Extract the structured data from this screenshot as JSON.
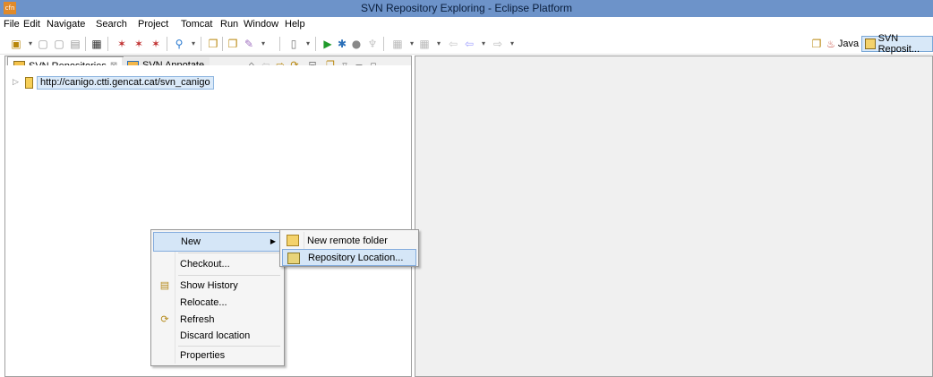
{
  "window": {
    "title": "SVN Repository Exploring - Eclipse Platform",
    "app_icon_text": "cfn"
  },
  "menubar": [
    "File",
    "Edit",
    "Navigate",
    "Search",
    "Project",
    "Tomcat",
    "Run",
    "Window",
    "Help"
  ],
  "perspectives": [
    {
      "label": "Java",
      "active": false
    },
    {
      "label": "SVN Reposit...",
      "active": true
    }
  ],
  "view_tabs": [
    {
      "label": "SVN Repositories",
      "close": "⊠",
      "active": true
    },
    {
      "label": "SVN Annotate",
      "active": false
    }
  ],
  "tree": [
    {
      "label": "http://canigo.ctti.gencat.cat/svn_canigo",
      "selected": true
    }
  ],
  "context_menu": {
    "items": [
      {
        "label": "New",
        "has_submenu": true,
        "highlight": true
      },
      {
        "label": "Checkout..."
      },
      {
        "label": "Show History",
        "icon": "history-icon"
      },
      {
        "label": "Relocate..."
      },
      {
        "label": "Refresh",
        "icon": "refresh-icon"
      },
      {
        "label": "Discard location"
      },
      {
        "label": "Properties"
      }
    ]
  },
  "submenu": {
    "items": [
      {
        "label": "New remote folder",
        "icon": "folder-icon"
      },
      {
        "label": "Repository Location...",
        "icon": "repository-location-icon",
        "highlight": true
      }
    ]
  },
  "colors": {
    "titlebar": "#6d93c9",
    "selection": "#d5e6f7",
    "selection_border": "#84acdd"
  }
}
